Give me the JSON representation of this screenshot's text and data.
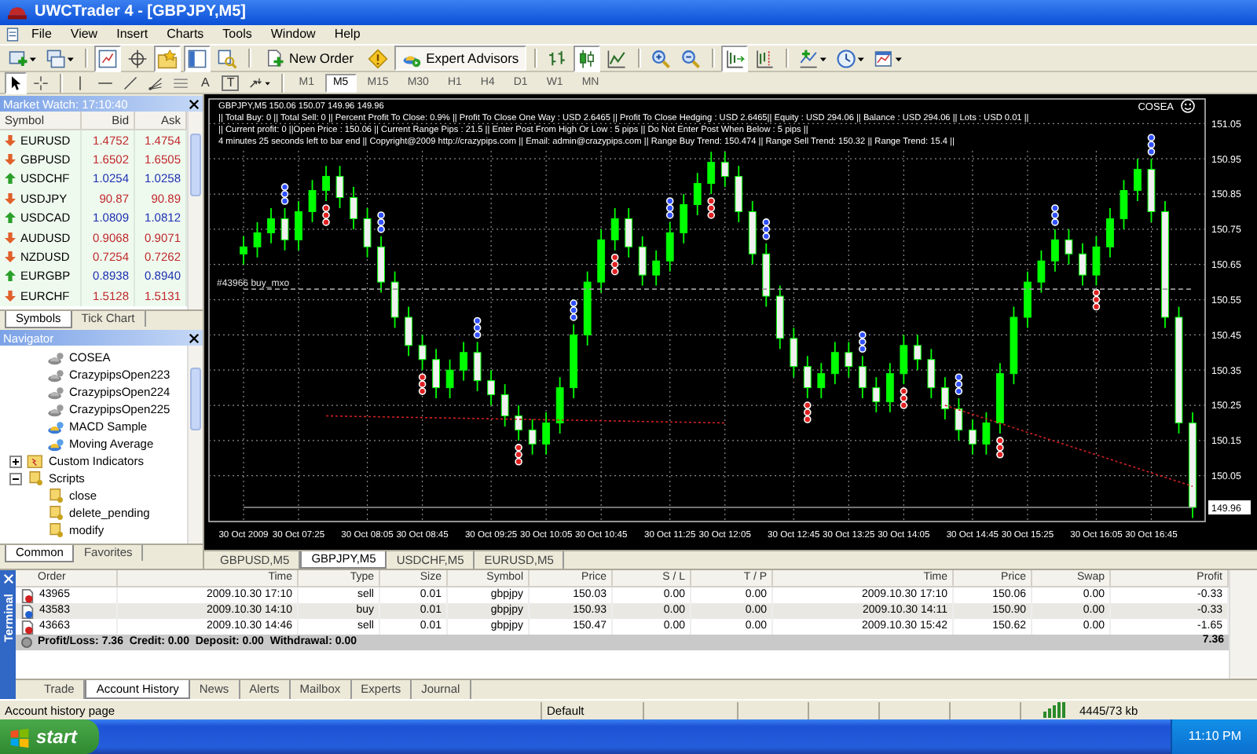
{
  "window": {
    "title": "UWCTrader 4 - [GBPJPY,M5]"
  },
  "menu": [
    "File",
    "View",
    "Insert",
    "Charts",
    "Tools",
    "Window",
    "Help"
  ],
  "toolbar": [
    {
      "kind": "new-chart",
      "on": false
    },
    {
      "kind": "profiles",
      "on": false
    },
    {
      "kind": "sep"
    },
    {
      "kind": "market-watch",
      "on": true
    },
    {
      "kind": "data-window",
      "on": false
    },
    {
      "kind": "navigator",
      "on": true
    },
    {
      "kind": "terminal",
      "on": true
    },
    {
      "kind": "tester",
      "on": false
    },
    {
      "kind": "sep"
    },
    {
      "kind": "new-order",
      "label": "New Order",
      "on": false
    },
    {
      "kind": "meta-editor",
      "on": false
    },
    {
      "kind": "expert-advisors",
      "label": "Expert Advisors",
      "on": true
    },
    {
      "kind": "sep"
    },
    {
      "kind": "bar-chart",
      "on": false
    },
    {
      "kind": "candles",
      "on": true
    },
    {
      "kind": "line-chart",
      "on": false
    },
    {
      "kind": "sep"
    },
    {
      "kind": "zoom-in",
      "on": false
    },
    {
      "kind": "zoom-out",
      "on": false
    },
    {
      "kind": "sep"
    },
    {
      "kind": "auto-scroll",
      "on": true
    },
    {
      "kind": "chart-shift",
      "on": false
    },
    {
      "kind": "sep"
    },
    {
      "kind": "indicators",
      "on": false
    },
    {
      "kind": "periods",
      "on": false
    },
    {
      "kind": "templates",
      "on": false
    }
  ],
  "drawing_tools": [
    {
      "kind": "cursor",
      "selected": true
    },
    {
      "kind": "crosshair",
      "selected": false
    },
    {
      "kind": "sep"
    },
    {
      "kind": "vline",
      "selected": false
    },
    {
      "kind": "hline",
      "selected": false
    },
    {
      "kind": "trendline",
      "selected": false
    },
    {
      "kind": "fibo",
      "selected": false
    },
    {
      "kind": "channel",
      "selected": false
    },
    {
      "kind": "text",
      "label": "A",
      "selected": false
    },
    {
      "kind": "label",
      "label": "T",
      "selected": false
    },
    {
      "kind": "arrows",
      "selected": false
    },
    {
      "kind": "sep"
    }
  ],
  "timeframes": [
    {
      "label": "M1",
      "selected": false
    },
    {
      "label": "M5",
      "selected": true
    },
    {
      "label": "M15",
      "selected": false
    },
    {
      "label": "M30",
      "selected": false
    },
    {
      "label": "H1",
      "selected": false
    },
    {
      "label": "H4",
      "selected": false
    },
    {
      "label": "D1",
      "selected": false
    },
    {
      "label": "W1",
      "selected": false
    },
    {
      "label": "MN",
      "selected": false
    }
  ],
  "market_watch": {
    "title": "Market Watch: 17:10:40",
    "columns": [
      "Symbol",
      "Bid",
      "Ask"
    ],
    "rows": [
      {
        "symbol": "EURUSD",
        "bid": "1.4752",
        "ask": "1.4754",
        "up": false
      },
      {
        "symbol": "GBPUSD",
        "bid": "1.6502",
        "ask": "1.6505",
        "up": false
      },
      {
        "symbol": "USDCHF",
        "bid": "1.0254",
        "ask": "1.0258",
        "up": true
      },
      {
        "symbol": "USDJPY",
        "bid": "90.87",
        "ask": "90.89",
        "up": false
      },
      {
        "symbol": "USDCAD",
        "bid": "1.0809",
        "ask": "1.0812",
        "up": true
      },
      {
        "symbol": "AUDUSD",
        "bid": "0.9068",
        "ask": "0.9071",
        "up": false
      },
      {
        "symbol": "NZDUSD",
        "bid": "0.7254",
        "ask": "0.7262",
        "up": false
      },
      {
        "symbol": "EURGBP",
        "bid": "0.8938",
        "ask": "0.8940",
        "up": true
      },
      {
        "symbol": "EURCHF",
        "bid": "1.5128",
        "ask": "1.5131",
        "up": false
      }
    ],
    "tabs": [
      {
        "label": "Symbols",
        "selected": true
      },
      {
        "label": "Tick Chart",
        "selected": false
      }
    ]
  },
  "navigator": {
    "title": "Navigator",
    "experts": [
      {
        "label": "COSEA",
        "kind": "custom"
      },
      {
        "label": "CrazypipsOpen223",
        "kind": "custom"
      },
      {
        "label": "CrazypipsOpen224",
        "kind": "custom"
      },
      {
        "label": "CrazypipsOpen225",
        "kind": "custom"
      },
      {
        "label": "MACD Sample",
        "kind": "sample"
      },
      {
        "label": "Moving Average",
        "kind": "sample"
      }
    ],
    "folders": [
      {
        "label": "Custom Indicators",
        "kind": "indicators",
        "expanded": false
      },
      {
        "label": "Scripts",
        "kind": "scripts",
        "expanded": true,
        "children": [
          {
            "label": "close"
          },
          {
            "label": "delete_pending"
          },
          {
            "label": "modify"
          }
        ]
      }
    ],
    "tabs": [
      {
        "label": "Common",
        "selected": true
      },
      {
        "label": "Favorites",
        "selected": false
      }
    ]
  },
  "chart": {
    "current_price": "149.96",
    "order_line_label": "#43966 buy_mxo",
    "header_lines": [
      "GBPJPY,M5  150.06 150.07 149.96 149.96",
      "|| Total Buy: 0 || Total Sell: 0 || Percent Profit To Close: 0.9% || Profit To Close One Way : USD 2.6465 || Profit To Close Hedging : USD 2.6465|| Equity : USD 294.06 || Balance : USD 294.06 || Lots : USD 0.01 ||",
      "|| Current profit: 0 ||Open Price : 150.06 || Current Range Pips : 21.5 || Enter Post From High Or Low : 5 pips || Do Not Enter Post When Below : 5 pips ||",
      "4 minutes 25 seconds left to bar end || Copyright@2009 http://crazypips.com || Email: admin@crazypips.com || Range Buy Trend: 150.474 || Range Sell Trend: 150.32 || Range Trend: 15.4 ||"
    ],
    "expert_name": "COSEA",
    "chart_data": {
      "type": "candlestick",
      "categories": [
        "30 Oct 2009",
        null,
        null,
        null,
        "30 Oct 07:25",
        null,
        null,
        null,
        null,
        "30 Oct 08:05",
        null,
        null,
        null,
        "30 Oct 08:45",
        null,
        null,
        null,
        null,
        "30 Oct 09:25",
        null,
        null,
        null,
        "30 Oct 10:05",
        null,
        null,
        null,
        "30 Oct 10:45",
        null,
        null,
        null,
        null,
        "30 Oct 11:25",
        null,
        null,
        null,
        "30 Oct 12:05",
        null,
        null,
        null,
        null,
        "30 Oct 12:45",
        null,
        null,
        null,
        "30 Oct 13:25",
        null,
        null,
        null,
        "30 Oct 14:05",
        null,
        null,
        null,
        null,
        "30 Oct 14:45",
        null,
        null,
        null,
        "30 Oct 15:25",
        null,
        null,
        null,
        null,
        "30 Oct 16:05",
        null,
        null,
        null,
        "30 Oct 16:45",
        null,
        null,
        null
      ],
      "ohlc": [
        [
          150.68,
          150.73,
          150.65,
          150.7
        ],
        [
          150.7,
          150.77,
          150.67,
          150.74
        ],
        [
          150.74,
          150.81,
          150.71,
          150.78
        ],
        [
          150.78,
          150.81,
          150.69,
          150.72
        ],
        [
          150.72,
          150.83,
          150.69,
          150.8
        ],
        [
          150.8,
          150.89,
          150.77,
          150.86
        ],
        [
          150.86,
          150.93,
          150.83,
          150.9
        ],
        [
          150.9,
          150.93,
          150.81,
          150.84
        ],
        [
          150.84,
          150.87,
          150.75,
          150.78
        ],
        [
          150.78,
          150.81,
          150.67,
          150.7
        ],
        [
          150.7,
          150.73,
          150.57,
          150.6
        ],
        [
          150.6,
          150.63,
          150.47,
          150.5
        ],
        [
          150.5,
          150.53,
          150.39,
          150.42
        ],
        [
          150.42,
          150.45,
          150.35,
          150.38
        ],
        [
          150.38,
          150.41,
          150.27,
          150.3
        ],
        [
          150.3,
          150.38,
          150.27,
          150.35
        ],
        [
          150.35,
          150.43,
          150.32,
          150.4
        ],
        [
          150.4,
          150.43,
          150.29,
          150.32
        ],
        [
          150.32,
          150.35,
          150.25,
          150.28
        ],
        [
          150.28,
          150.31,
          150.19,
          150.22
        ],
        [
          150.22,
          150.25,
          150.15,
          150.18
        ],
        [
          150.18,
          150.21,
          150.11,
          150.14
        ],
        [
          150.14,
          150.23,
          150.11,
          150.2
        ],
        [
          150.2,
          150.33,
          150.17,
          150.3
        ],
        [
          150.3,
          150.48,
          150.27,
          150.45
        ],
        [
          150.45,
          150.63,
          150.42,
          150.6
        ],
        [
          150.6,
          150.75,
          150.57,
          150.72
        ],
        [
          150.72,
          150.81,
          150.69,
          150.78
        ],
        [
          150.78,
          150.81,
          150.67,
          150.7
        ],
        [
          150.7,
          150.73,
          150.59,
          150.62
        ],
        [
          150.62,
          150.69,
          150.59,
          150.66
        ],
        [
          150.66,
          150.77,
          150.63,
          150.74
        ],
        [
          150.74,
          150.85,
          150.71,
          150.82
        ],
        [
          150.82,
          150.91,
          150.79,
          150.88
        ],
        [
          150.88,
          150.97,
          150.85,
          150.94
        ],
        [
          150.94,
          150.97,
          150.87,
          150.9
        ],
        [
          150.9,
          150.93,
          150.77,
          150.8
        ],
        [
          150.8,
          150.83,
          150.65,
          150.68
        ],
        [
          150.68,
          150.71,
          150.53,
          150.56
        ],
        [
          150.56,
          150.59,
          150.41,
          150.44
        ],
        [
          150.44,
          150.47,
          150.33,
          150.36
        ],
        [
          150.36,
          150.39,
          150.27,
          150.3
        ],
        [
          150.3,
          150.37,
          150.27,
          150.34
        ],
        [
          150.34,
          150.43,
          150.31,
          150.4
        ],
        [
          150.4,
          150.43,
          150.33,
          150.36
        ],
        [
          150.36,
          150.39,
          150.27,
          150.3
        ],
        [
          150.3,
          150.33,
          150.23,
          150.26
        ],
        [
          150.26,
          150.37,
          150.23,
          150.34
        ],
        [
          150.34,
          150.45,
          150.31,
          150.42
        ],
        [
          150.42,
          150.45,
          150.35,
          150.38
        ],
        [
          150.38,
          150.41,
          150.27,
          150.3
        ],
        [
          150.3,
          150.33,
          150.21,
          150.24
        ],
        [
          150.24,
          150.27,
          150.15,
          150.18
        ],
        [
          150.18,
          150.21,
          150.11,
          150.14
        ],
        [
          150.14,
          150.23,
          150.11,
          150.2
        ],
        [
          150.2,
          150.37,
          150.17,
          150.34
        ],
        [
          150.34,
          150.53,
          150.31,
          150.5
        ],
        [
          150.5,
          150.63,
          150.47,
          150.6
        ],
        [
          150.6,
          150.69,
          150.57,
          150.66
        ],
        [
          150.66,
          150.75,
          150.63,
          150.72
        ],
        [
          150.72,
          150.75,
          150.65,
          150.68
        ],
        [
          150.68,
          150.71,
          150.59,
          150.62
        ],
        [
          150.62,
          150.73,
          150.59,
          150.7
        ],
        [
          150.7,
          150.81,
          150.67,
          150.78
        ],
        [
          150.78,
          150.89,
          150.75,
          150.86
        ],
        [
          150.86,
          150.95,
          150.83,
          150.92
        ],
        [
          150.92,
          150.95,
          150.77,
          150.8
        ],
        [
          150.8,
          150.83,
          150.47,
          150.5
        ],
        [
          150.5,
          150.53,
          150.17,
          150.2
        ],
        [
          150.2,
          150.23,
          149.93,
          149.96
        ]
      ],
      "ylim": [
        149.92,
        151.12
      ],
      "grid": true,
      "series": [
        {
          "type": "scatter",
          "color": "#3050ff",
          "values": [
            null,
            null,
            null,
            150.83,
            null,
            null,
            null,
            null,
            null,
            null,
            150.75,
            null,
            null,
            null,
            null,
            null,
            null,
            150.45,
            null,
            null,
            null,
            null,
            null,
            null,
            150.5,
            null,
            null,
            null,
            null,
            null,
            null,
            150.79,
            null,
            null,
            null,
            null,
            null,
            null,
            150.73,
            null,
            null,
            null,
            null,
            null,
            null,
            150.41,
            null,
            null,
            null,
            null,
            null,
            null,
            150.29,
            null,
            null,
            null,
            null,
            null,
            null,
            150.77,
            null,
            null,
            null,
            null,
            null,
            null,
            150.97,
            null,
            null,
            null
          ]
        },
        {
          "type": "scatter",
          "color": "#3050ff",
          "values": [
            null,
            null,
            null,
            150.85,
            null,
            null,
            null,
            null,
            null,
            null,
            150.77,
            null,
            null,
            null,
            null,
            null,
            null,
            150.47,
            null,
            null,
            null,
            null,
            null,
            null,
            150.52,
            null,
            null,
            null,
            null,
            null,
            null,
            150.81,
            null,
            null,
            null,
            null,
            null,
            null,
            150.75,
            null,
            null,
            null,
            null,
            null,
            null,
            150.43,
            null,
            null,
            null,
            null,
            null,
            null,
            150.31,
            null,
            null,
            null,
            null,
            null,
            null,
            150.79,
            null,
            null,
            null,
            null,
            null,
            null,
            150.99,
            null,
            null,
            null
          ]
        },
        {
          "type": "scatter",
          "color": "#3050ff",
          "values": [
            null,
            null,
            null,
            150.87,
            null,
            null,
            null,
            null,
            null,
            null,
            150.79,
            null,
            null,
            null,
            null,
            null,
            null,
            150.49,
            null,
            null,
            null,
            null,
            null,
            null,
            150.54,
            null,
            null,
            null,
            null,
            null,
            null,
            150.83,
            null,
            null,
            null,
            null,
            null,
            null,
            150.77,
            null,
            null,
            null,
            null,
            null,
            null,
            150.45,
            null,
            null,
            null,
            null,
            null,
            null,
            150.33,
            null,
            null,
            null,
            null,
            null,
            null,
            150.81,
            null,
            null,
            null,
            null,
            null,
            null,
            151.01,
            null,
            null,
            null
          ]
        },
        {
          "type": "scatter",
          "color": "#e02020",
          "values": [
            null,
            null,
            null,
            null,
            null,
            null,
            150.81,
            null,
            null,
            null,
            null,
            null,
            null,
            150.33,
            null,
            null,
            null,
            null,
            null,
            null,
            150.13,
            null,
            null,
            null,
            null,
            null,
            null,
            150.67,
            null,
            null,
            null,
            null,
            null,
            null,
            150.83,
            null,
            null,
            null,
            null,
            null,
            null,
            150.25,
            null,
            null,
            null,
            null,
            null,
            null,
            150.29,
            null,
            null,
            null,
            null,
            null,
            null,
            150.15,
            null,
            null,
            null,
            null,
            null,
            null,
            150.57,
            null,
            null,
            null,
            null,
            null,
            null,
            null
          ]
        },
        {
          "type": "scatter",
          "color": "#e02020",
          "values": [
            null,
            null,
            null,
            null,
            null,
            null,
            150.79,
            null,
            null,
            null,
            null,
            null,
            null,
            150.31,
            null,
            null,
            null,
            null,
            null,
            null,
            150.11,
            null,
            null,
            null,
            null,
            null,
            null,
            150.65,
            null,
            null,
            null,
            null,
            null,
            null,
            150.81,
            null,
            null,
            null,
            null,
            null,
            null,
            150.23,
            null,
            null,
            null,
            null,
            null,
            null,
            150.27,
            null,
            null,
            null,
            null,
            null,
            null,
            150.13,
            null,
            null,
            null,
            null,
            null,
            null,
            150.55,
            null,
            null,
            null,
            null,
            null,
            null,
            null
          ]
        },
        {
          "type": "scatter",
          "color": "#e02020",
          "values": [
            null,
            null,
            null,
            null,
            null,
            null,
            150.77,
            null,
            null,
            null,
            null,
            null,
            null,
            150.29,
            null,
            null,
            null,
            null,
            null,
            null,
            150.09,
            null,
            null,
            null,
            null,
            null,
            null,
            150.63,
            null,
            null,
            null,
            null,
            null,
            null,
            150.79,
            null,
            null,
            null,
            null,
            null,
            null,
            150.21,
            null,
            null,
            null,
            null,
            null,
            null,
            150.25,
            null,
            null,
            null,
            null,
            null,
            null,
            150.11,
            null,
            null,
            null,
            null,
            null,
            null,
            150.53,
            null,
            null,
            null,
            null,
            null,
            null,
            null
          ]
        },
        {
          "type": "line",
          "color": "#d02020",
          "line_style": "dashed",
          "values": [
            null,
            null,
            null,
            null,
            null,
            null,
            150.22,
            null,
            null,
            null,
            null,
            null,
            null,
            null,
            null,
            null,
            null,
            null,
            null,
            null,
            null,
            null,
            null,
            null,
            null,
            null,
            null,
            null,
            null,
            null,
            null,
            null,
            null,
            null,
            null,
            150.2,
            null,
            null,
            null,
            null,
            null,
            null,
            null,
            null,
            null,
            null,
            null,
            null,
            null,
            null,
            null,
            null,
            null,
            null,
            null,
            null,
            null,
            null,
            null,
            null,
            null,
            null,
            null,
            null,
            null,
            null,
            null,
            null,
            null,
            null
          ]
        },
        {
          "type": "line",
          "color": "#d02020",
          "line_style": "dashed",
          "values": [
            null,
            null,
            null,
            null,
            null,
            null,
            null,
            null,
            null,
            null,
            null,
            null,
            null,
            null,
            null,
            null,
            null,
            null,
            null,
            null,
            null,
            null,
            null,
            null,
            null,
            null,
            null,
            null,
            null,
            null,
            null,
            null,
            null,
            null,
            null,
            null,
            null,
            null,
            null,
            null,
            null,
            null,
            null,
            null,
            null,
            null,
            null,
            null,
            null,
            null,
            null,
            150.25,
            null,
            null,
            null,
            null,
            null,
            null,
            null,
            null,
            null,
            null,
            null,
            null,
            null,
            null,
            null,
            null,
            null,
            150.02
          ]
        },
        {
          "type": "line",
          "color": "#9a9a9a",
          "line_style": "dotted",
          "values": [
            150.58,
            150.58,
            150.58,
            150.58,
            150.58,
            150.58,
            150.58,
            150.58,
            150.58,
            150.58,
            150.58,
            150.58,
            150.58,
            150.58,
            150.58,
            150.58,
            150.58,
            150.58,
            150.58,
            150.58,
            150.58,
            150.58,
            150.58,
            150.58,
            150.58,
            150.58,
            150.58,
            150.58,
            150.58,
            150.58,
            150.58,
            150.58,
            150.58,
            150.58,
            150.58,
            150.58,
            150.58,
            150.58,
            150.58,
            150.58,
            150.58,
            150.58,
            150.58,
            150.58,
            150.58,
            150.58,
            150.58,
            150.58,
            150.58,
            150.58,
            150.58,
            150.58,
            150.58,
            150.58,
            150.58,
            150.58,
            150.58,
            150.58,
            150.58,
            150.58,
            150.58,
            150.58,
            150.58,
            150.58,
            150.58,
            150.58,
            150.58,
            150.58,
            150.58,
            150.58
          ]
        },
        {
          "type": "line",
          "color": "#9a9a9a",
          "line_style": "solid",
          "values": [
            149.96,
            149.96,
            149.96,
            149.96,
            149.96,
            149.96,
            149.96,
            149.96,
            149.96,
            149.96,
            149.96,
            149.96,
            149.96,
            149.96,
            149.96,
            149.96,
            149.96,
            149.96,
            149.96,
            149.96,
            149.96,
            149.96,
            149.96,
            149.96,
            149.96,
            149.96,
            149.96,
            149.96,
            149.96,
            149.96,
            149.96,
            149.96,
            149.96,
            149.96,
            149.96,
            149.96,
            149.96,
            149.96,
            149.96,
            149.96,
            149.96,
            149.96,
            149.96,
            149.96,
            149.96,
            149.96,
            149.96,
            149.96,
            149.96,
            149.96,
            149.96,
            149.96,
            149.96,
            149.96,
            149.96,
            149.96,
            149.96,
            149.96,
            149.96,
            149.96,
            149.96,
            149.96,
            149.96,
            149.96,
            149.96,
            149.96,
            149.96,
            149.96,
            149.96,
            149.96
          ]
        }
      ],
      "yticks": [
        {
          "value": 151.05,
          "label": "151.05"
        },
        {
          "value": 150.95,
          "label": "150.95"
        },
        {
          "value": 150.85,
          "label": "150.85"
        },
        {
          "value": 150.75,
          "label": "150.75"
        },
        {
          "value": 150.65,
          "label": "150.65"
        },
        {
          "value": 150.55,
          "label": "150.55"
        },
        {
          "value": 150.45,
          "label": "150.45"
        },
        {
          "value": 150.35,
          "label": "150.35"
        },
        {
          "value": 150.25,
          "label": "150.25"
        },
        {
          "value": 150.15,
          "label": "150.15"
        },
        {
          "value": 150.05,
          "label": "150.05"
        }
      ]
    }
  },
  "chart_tabs": [
    {
      "label": "GBPUSD,M5",
      "selected": false
    },
    {
      "label": "GBPJPY,M5",
      "selected": true
    },
    {
      "label": "USDCHF,M5",
      "selected": false
    },
    {
      "label": "EURUSD,M5",
      "selected": false
    }
  ],
  "terminal": {
    "title": "Terminal",
    "columns": [
      "Order",
      "Time",
      "Type",
      "Size",
      "Symbol",
      "Price",
      "S / L",
      "T / P",
      "Time",
      "Price",
      "Swap",
      "Profit"
    ],
    "rows": [
      {
        "kind": "sell",
        "cells": [
          "43965",
          "2009.10.30 17:10",
          "sell",
          "0.01",
          "gbpjpy",
          "150.03",
          "0.00",
          "0.00",
          "2009.10.30 17:10",
          "150.06",
          "0.00",
          "-0.33"
        ]
      },
      {
        "kind": "buy",
        "cells": [
          "43583",
          "2009.10.30 14:10",
          "buy",
          "0.01",
          "gbpjpy",
          "150.93",
          "0.00",
          "0.00",
          "2009.10.30 14:11",
          "150.90",
          "0.00",
          "-0.33"
        ]
      },
      {
        "kind": "sell",
        "cells": [
          "43663",
          "2009.10.30 14:46",
          "sell",
          "0.01",
          "gbpjpy",
          "150.47",
          "0.00",
          "0.00",
          "2009.10.30 15:42",
          "150.62",
          "0.00",
          "-1.65"
        ]
      }
    ],
    "summary": "Profit/Loss: 7.36  Credit: 0.00  Deposit: 0.00  Withdrawal: 0.00",
    "summary_total": "7.36",
    "tabs": [
      {
        "label": "Trade",
        "selected": false
      },
      {
        "label": "Account History",
        "selected": true
      },
      {
        "label": "News",
        "selected": false
      },
      {
        "label": "Alerts",
        "selected": false
      },
      {
        "label": "Mailbox",
        "selected": false
      },
      {
        "label": "Experts",
        "selected": false
      },
      {
        "label": "Journal",
        "selected": false
      }
    ]
  },
  "status_bar": {
    "message": "Account history page",
    "profile": "Default",
    "traffic": "4445/73 kb"
  },
  "taskbar": {
    "start": "start",
    "clock": "11:10 PM"
  }
}
